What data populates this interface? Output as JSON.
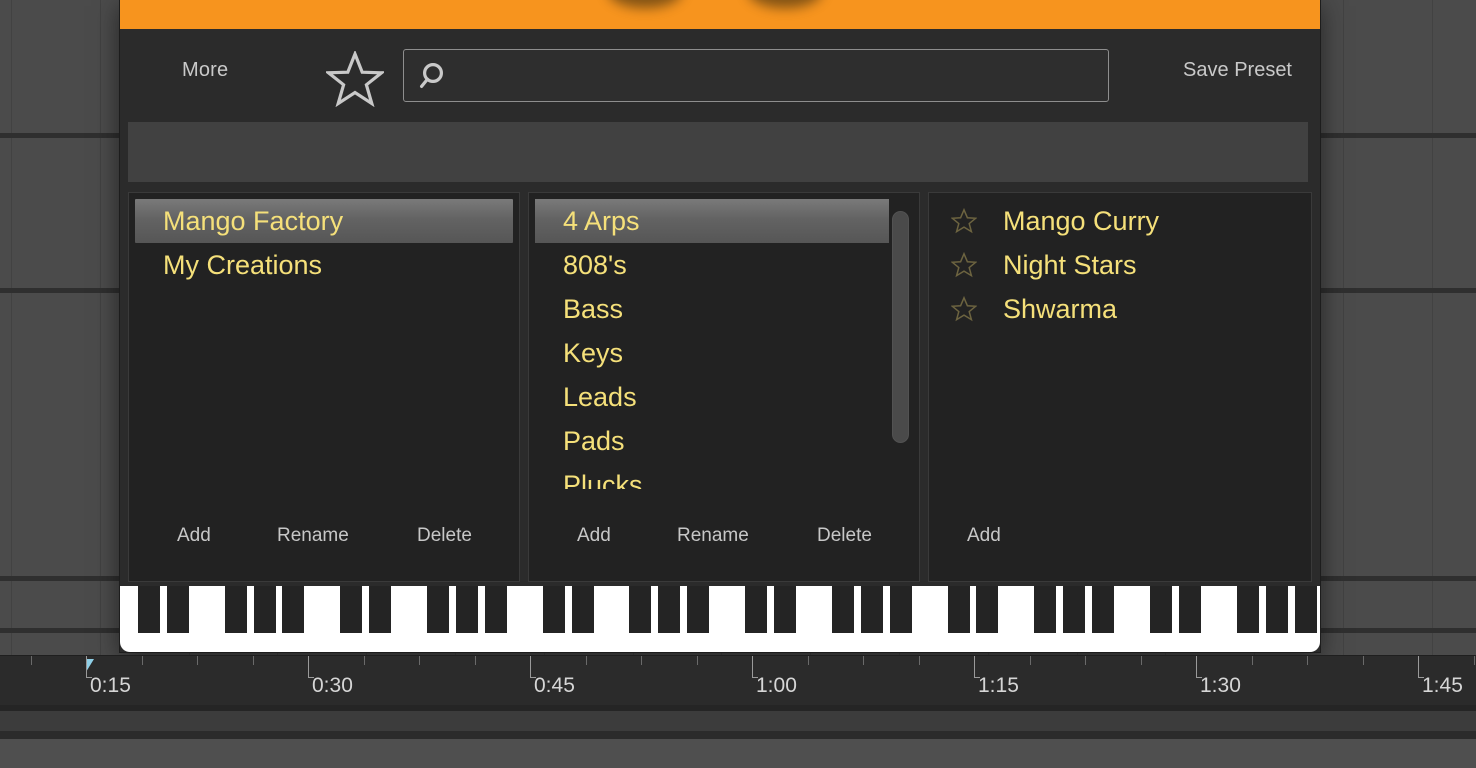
{
  "window": {
    "accent_color": "#f7941e",
    "background_color": "#2b2b2b",
    "list_text_color": "#f5e07a"
  },
  "toolbar": {
    "more_label": "More",
    "favorite_icon": "star-outline-icon",
    "search_icon": "magnifier-icon",
    "search_value": "",
    "search_placeholder": "",
    "save_preset_label": "Save Preset"
  },
  "columns": [
    {
      "name": "banks",
      "items": [
        {
          "label": "Mango Factory",
          "selected": true
        },
        {
          "label": "My Creations",
          "selected": false
        }
      ],
      "actions": [
        "Add",
        "Rename",
        "Delete"
      ],
      "scrollbar": false
    },
    {
      "name": "categories",
      "items": [
        {
          "label": "4 Arps",
          "selected": true
        },
        {
          "label": "808's",
          "selected": false
        },
        {
          "label": "Bass",
          "selected": false
        },
        {
          "label": "Keys",
          "selected": false
        },
        {
          "label": "Leads",
          "selected": false
        },
        {
          "label": "Pads",
          "selected": false
        },
        {
          "label": "Plucks",
          "selected": false
        }
      ],
      "actions": [
        "Add",
        "Rename",
        "Delete"
      ],
      "scrollbar": true
    },
    {
      "name": "presets",
      "items": [
        {
          "label": "Mango Curry",
          "selected": false,
          "star": "star-outline-icon"
        },
        {
          "label": "Night Stars",
          "selected": false,
          "star": "star-outline-icon"
        },
        {
          "label": "Shwarma",
          "selected": false,
          "star": "star-outline-icon"
        }
      ],
      "actions": [
        "Add"
      ],
      "scrollbar": false
    }
  ],
  "ruler": {
    "labels": [
      "0:15",
      "0:30",
      "0:45",
      "1:00",
      "1:15",
      "1:30",
      "1:45"
    ],
    "playhead_label": "0:15"
  }
}
